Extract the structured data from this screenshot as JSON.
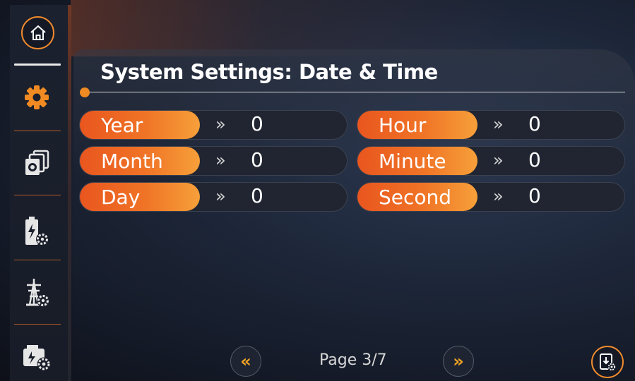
{
  "page": {
    "title": "System Settings: Date & Time"
  },
  "sidebar": {
    "items": [
      {
        "icon": "home-icon"
      },
      {
        "icon": "gear-icon",
        "active_color": "#f08a22"
      },
      {
        "icon": "multi-device-settings-icon"
      },
      {
        "icon": "battery-settings-icon"
      },
      {
        "icon": "grid-tower-settings-icon"
      },
      {
        "icon": "generator-settings-icon"
      }
    ]
  },
  "fields": {
    "left": [
      {
        "label": "Year",
        "arrow": "»",
        "value": "0"
      },
      {
        "label": "Month",
        "arrow": "»",
        "value": "0"
      },
      {
        "label": "Day",
        "arrow": "»",
        "value": "0"
      }
    ],
    "right": [
      {
        "label": "Hour",
        "arrow": "»",
        "value": "0"
      },
      {
        "label": "Minute",
        "arrow": "»",
        "value": "0"
      },
      {
        "label": "Second",
        "arrow": "»",
        "value": "0"
      }
    ]
  },
  "footer": {
    "prev_label": "«",
    "next_label": "»",
    "page_indicator": "Page 3/7",
    "export_icon": "export-settings-icon"
  },
  "colors": {
    "accent": "#f08a22",
    "label_gradient_start": "#e9561f",
    "label_gradient_end": "#f6a03a",
    "nav_arrow": "#f4a424"
  }
}
